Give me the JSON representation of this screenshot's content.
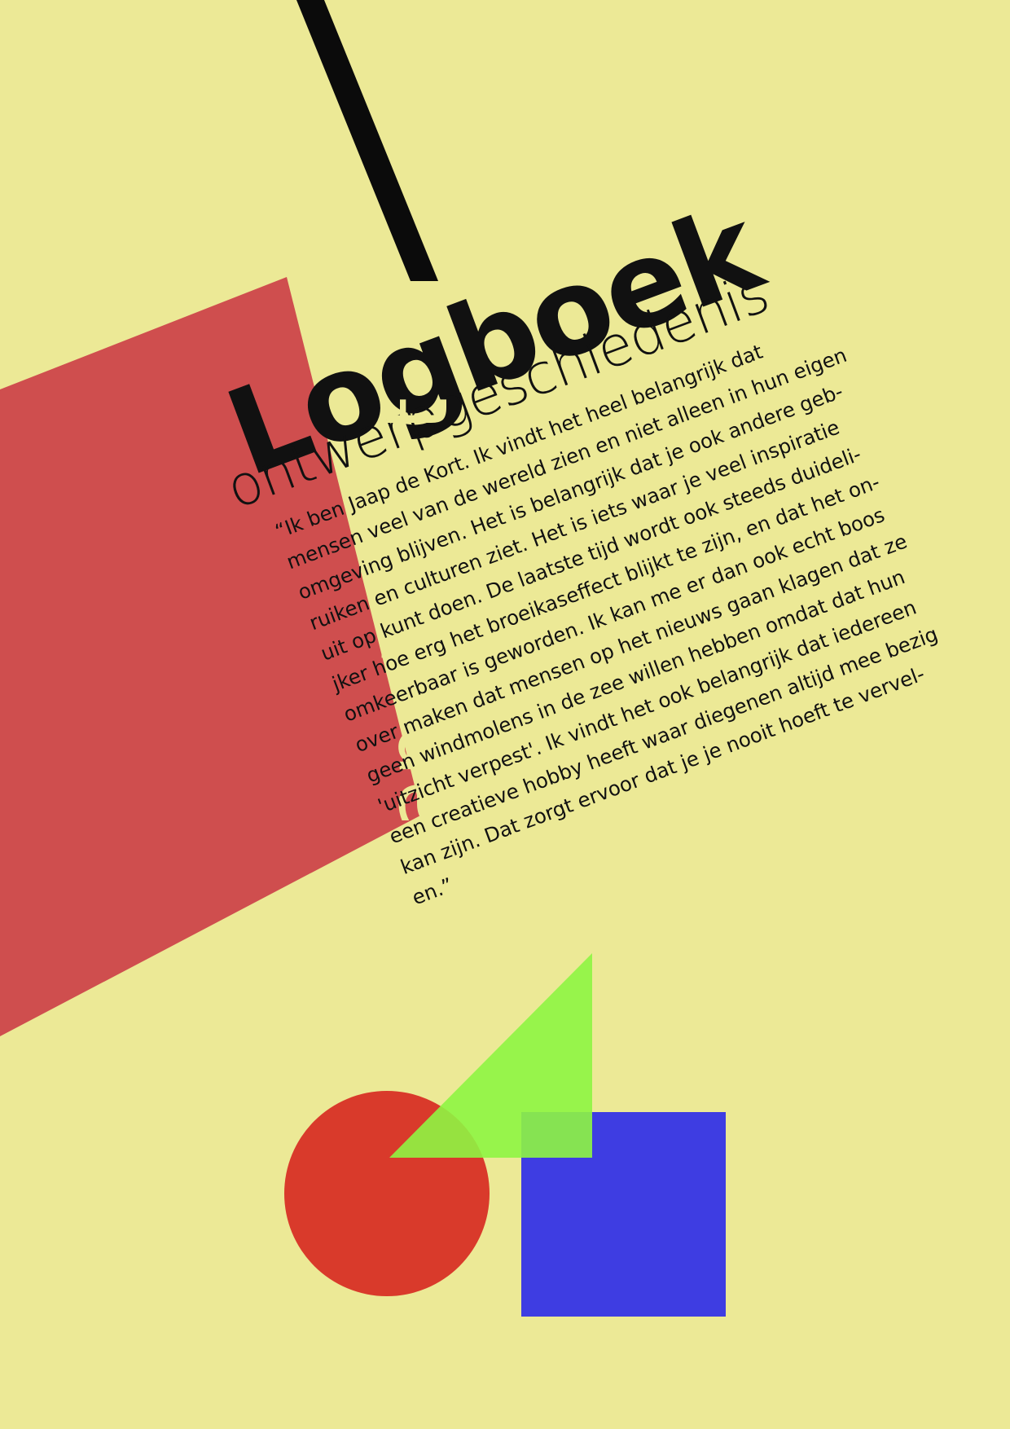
{
  "poster": {
    "background": "#ece996",
    "title": "Logboek",
    "subtitle": "ontwerpgeschiedenis",
    "author": "jaap de kort",
    "quote_lines": [
      "“Ik ben Jaap de Kort. Ik vindt het heel belangrijk dat",
      "mensen veel van de wereld zien en niet alleen in hun eigen",
      "omgeving blijven. Het is belangrijk dat je ook andere geb-",
      "ruiken en culturen ziet. Het is iets waar je veel inspiratie",
      "uit op kunt doen. De laatste tijd wordt ook steeds duideli-",
      "jker hoe erg het broeikaseffect blijkt te zijn, en dat het on-",
      "omkeerbaar is geworden. Ik kan me er dan ook echt boos",
      "over maken dat mensen op het nieuws gaan klagen dat ze",
      "geen windmolens in de zee willen hebben omdat dat hun",
      "'uitzicht verpest'. Ik vindt het ook belangrijk dat iedereen",
      "een creatieve hobby heeft waar diegenen altijd mee bezig",
      "kan zijn. Dat zorgt ervoor dat je je nooit hoeft te vervel-",
      "en.”"
    ],
    "colors": {
      "background": "#ece996",
      "band": "#cf4e4e",
      "author_text": "#ece996",
      "text": "#111111",
      "bar": "#0b0b0b",
      "circle": "#d93a2b",
      "triangle": "#8ef542",
      "square": "#3e3de2"
    },
    "shapes": [
      "circle",
      "triangle",
      "square"
    ]
  }
}
